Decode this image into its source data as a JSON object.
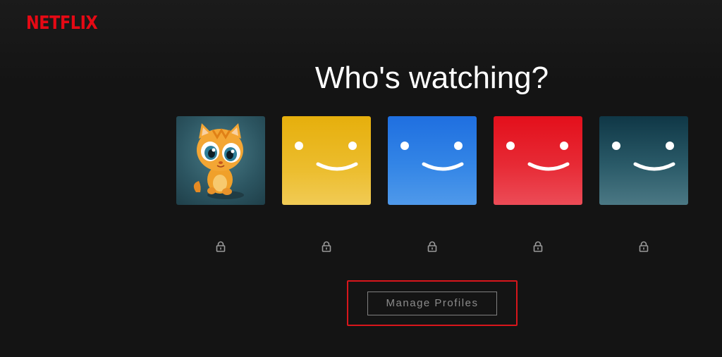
{
  "brand": {
    "logo_text": "NETFLIX",
    "color": "#e50914"
  },
  "heading": "Who's watching?",
  "profiles": [
    {
      "avatar": "cartoon-kitten",
      "colors": [
        "#3b6a78",
        "#24404a"
      ],
      "locked": true,
      "lock_icon": "lock-icon"
    },
    {
      "avatar": "smiley-yellow",
      "colors": [
        "#e8b20f",
        "#f0c94a"
      ],
      "locked": true,
      "lock_icon": "lock-icon"
    },
    {
      "avatar": "smiley-blue",
      "colors": [
        "#2275e0",
        "#4b96ea"
      ],
      "locked": true,
      "lock_icon": "lock-icon"
    },
    {
      "avatar": "smiley-red",
      "colors": [
        "#e5111d",
        "#ec4a55"
      ],
      "locked": true,
      "lock_icon": "lock-icon"
    },
    {
      "avatar": "smiley-teal",
      "colors": [
        "#123846",
        "#4a7784"
      ],
      "locked": true,
      "lock_icon": "lock-icon"
    }
  ],
  "manage_button": {
    "label": "Manage Profiles",
    "highlight_color": "#d8161c"
  }
}
